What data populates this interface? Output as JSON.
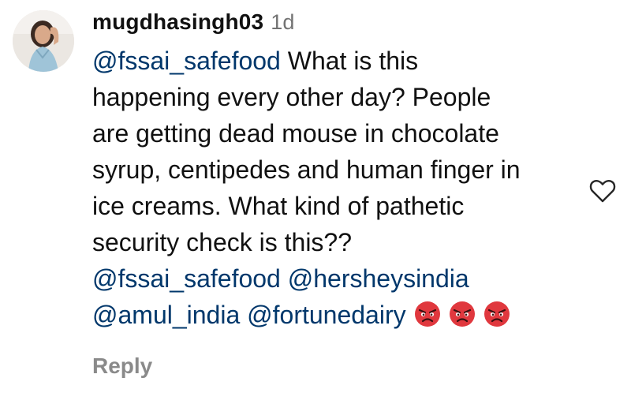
{
  "comment": {
    "username": "mugdhasingh03",
    "time": "1d",
    "body": {
      "mention_1": "@fssai_safefood",
      "line_1_text": " What is this",
      "line_2": "happening every other day? People",
      "line_3": "are getting dead mouse in chocolate",
      "line_4": "syrup, centipedes and human finger in",
      "line_5": "ice creams. What kind of pathetic",
      "line_6": "security check is this??",
      "mention_2": "@fssai_safefood",
      "mention_3": "@hersheysindia",
      "mention_4": "@amul_india",
      "mention_5": "@fortunedairy"
    },
    "emojis": [
      "angry-face-emoji",
      "angry-face-emoji",
      "angry-face-emoji"
    ],
    "reply_label": "Reply",
    "like_icon": "heart-outline-icon"
  },
  "colors": {
    "text": "#111111",
    "mention": "#00376b",
    "muted": "#737373",
    "reply": "#8a8a8a",
    "emoji_red": "#e0383e"
  }
}
